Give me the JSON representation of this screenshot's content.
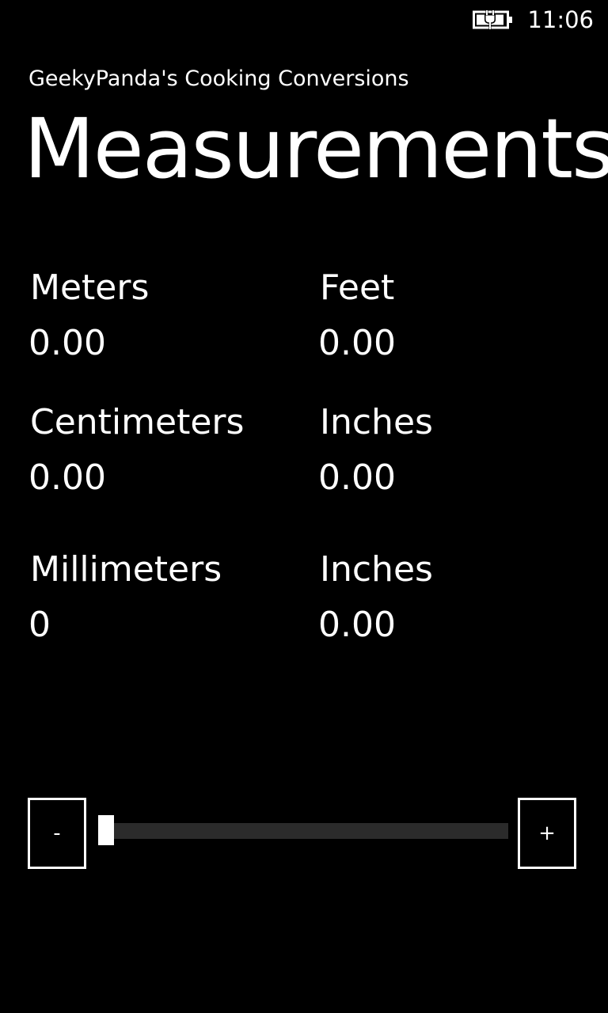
{
  "status_bar": {
    "time": "11:06",
    "battery_icon": "battery-charging-icon"
  },
  "header": {
    "app_title": "GeekyPanda's Cooking Conversions",
    "page_title": "Measurements"
  },
  "conversions": [
    {
      "left": {
        "label": "Meters",
        "value": "0.00"
      },
      "right": {
        "label": "Feet",
        "value": "0.00"
      }
    },
    {
      "left": {
        "label": "Centimeters",
        "value": "0.00"
      },
      "right": {
        "label": "Inches",
        "value": "0.00"
      }
    },
    {
      "left": {
        "label": "Millimeters",
        "value": "0"
      },
      "right": {
        "label": "Inches",
        "value": "0.00"
      }
    }
  ],
  "controls": {
    "minus_label": "-",
    "plus_label": "+",
    "slider_value": 0
  },
  "colors": {
    "background": "#000000",
    "foreground": "#ffffff",
    "track": "#2b2b2b"
  }
}
